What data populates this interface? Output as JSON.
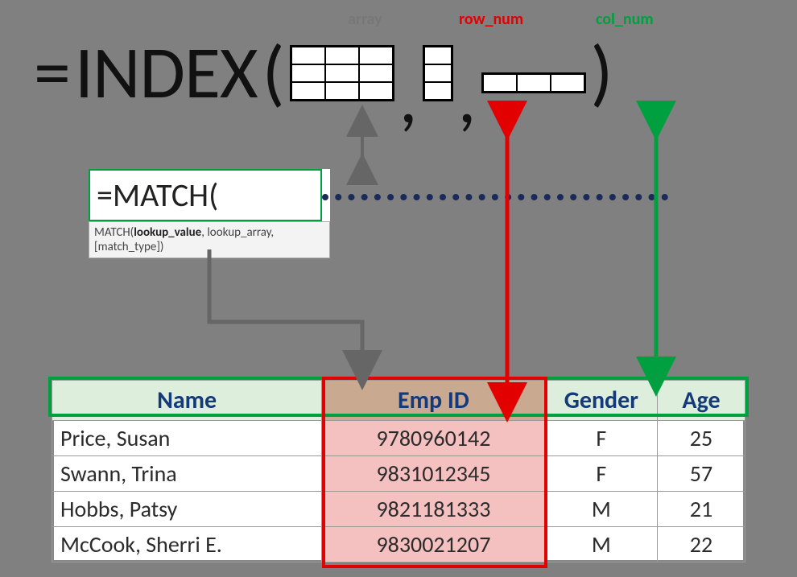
{
  "formula": {
    "equals": "=",
    "func": "INDEX",
    "open": "(",
    "close": ")",
    "comma": ","
  },
  "labels": {
    "array": "array",
    "row": "row_num",
    "col": "col_num"
  },
  "match": {
    "display": "=MATCH(",
    "tooltip_prefix": "MATCH(",
    "tooltip_bold": "lookup_value",
    "tooltip_rest": ", lookup_array, [match_type])"
  },
  "table": {
    "headers": {
      "name": "Name",
      "empid": "Emp ID",
      "gender": "Gender",
      "age": "Age"
    },
    "rows": [
      {
        "name": "Price, Susan",
        "empid": "9780960142",
        "gender": "F",
        "age": "25"
      },
      {
        "name": "Swann, Trina",
        "empid": "9831012345",
        "gender": "F",
        "age": "57"
      },
      {
        "name": "Hobbs, Patsy",
        "empid": "9821181333",
        "gender": "M",
        "age": "21"
      },
      {
        "name": "McCook, Sherri E.",
        "empid": "9830021207",
        "gender": "M",
        "age": "22"
      }
    ]
  }
}
